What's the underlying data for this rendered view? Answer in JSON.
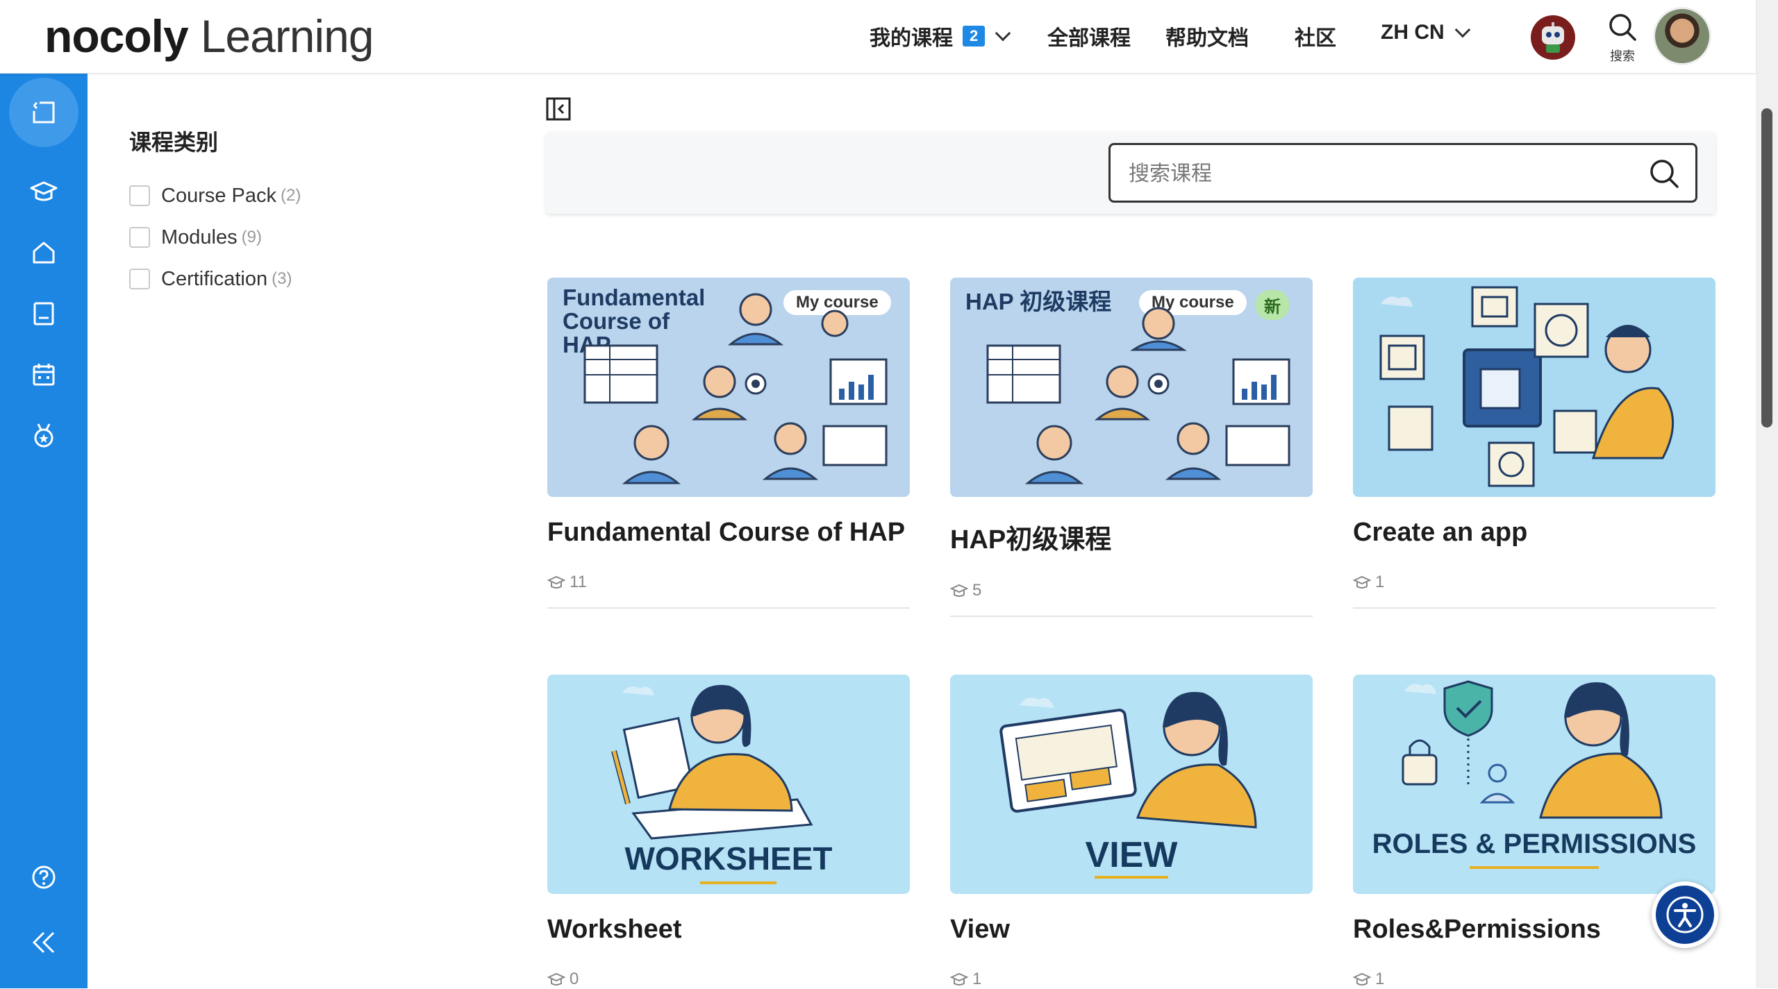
{
  "header": {
    "brand": "nocoly",
    "brand_sub": "Learning",
    "nav": {
      "my_courses": "我的课程",
      "my_courses_badge": "2",
      "all_courses": "全部课程",
      "help_docs": "帮助文档",
      "community": "社区",
      "language": "ZH CN"
    },
    "search_label": "搜索"
  },
  "filters": {
    "heading": "课程类别",
    "items": [
      {
        "label": "Course Pack",
        "count": "(2)"
      },
      {
        "label": "Modules",
        "count": "(9)"
      },
      {
        "label": "Certification",
        "count": "(3)"
      }
    ]
  },
  "search": {
    "placeholder": "搜索课程"
  },
  "courses": [
    {
      "title": "Fundamental Course of HAP",
      "count": "11",
      "thumb_title": "Fundamental Course of HAP",
      "tag": "My course",
      "bg": "#b9d4ec"
    },
    {
      "title": "HAP初级课程",
      "count": "5",
      "thumb_title": "HAP 初级课程",
      "tag": "My course",
      "new_tag": "新",
      "bg": "#b9d4ec"
    },
    {
      "title": "Create an app",
      "count": "1",
      "bg": "#a9daf2"
    },
    {
      "title": "Worksheet",
      "count": "0",
      "thumb_word": "WORKSHEET",
      "bg": "#b6e2f6"
    },
    {
      "title": "View",
      "count": "1",
      "thumb_word": "VIEW",
      "bg": "#b6e2f6"
    },
    {
      "title": "Roles&Permissions",
      "count": "1",
      "thumb_word": "ROLES & PERMISSIONS",
      "bg": "#b6e2f6"
    }
  ],
  "colors": {
    "sidebar": "#1d86e2",
    "accent": "#1e88e5",
    "a11y_button": "#0d3f95"
  }
}
